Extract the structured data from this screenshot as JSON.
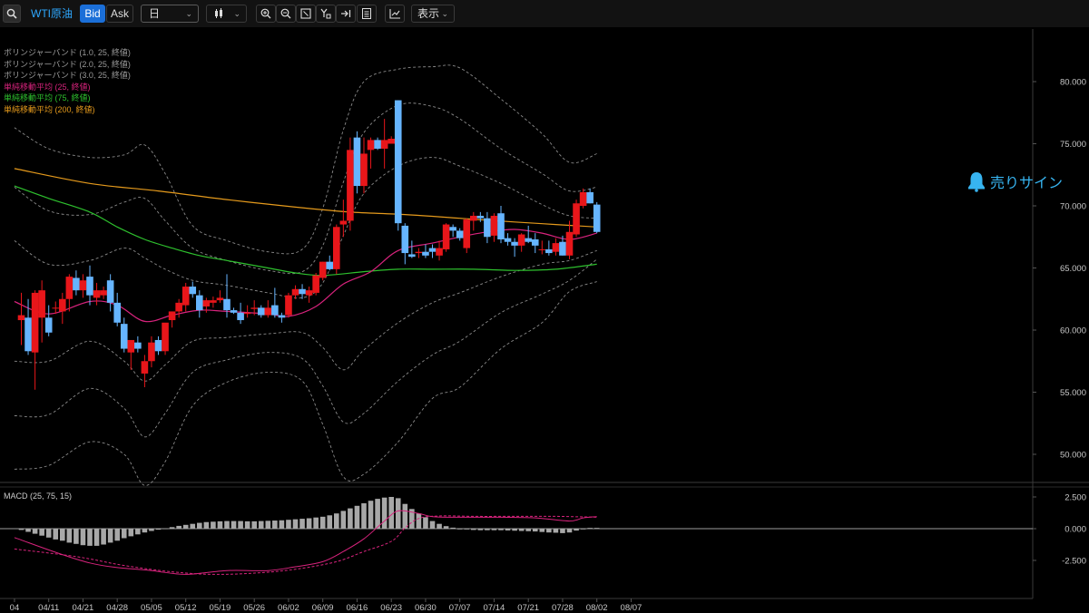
{
  "toolbar": {
    "symbol": "WTI原油",
    "bid": "Bid",
    "ask": "Ask",
    "timeframe": "日",
    "display": "表示"
  },
  "legend": [
    {
      "text": "ボリンジャーバンド (1.0, 25, 終値)",
      "color": "#9a9a9a"
    },
    {
      "text": "ボリンジャーバンド (2.0, 25, 終値)",
      "color": "#9a9a9a"
    },
    {
      "text": "ボリンジャーバンド (3.0, 25, 終値)",
      "color": "#9a9a9a"
    },
    {
      "text": "単純移動平均 (25, 終値)",
      "color": "#d8237d"
    },
    {
      "text": "単純移動平均 (75, 終値)",
      "color": "#2ec12e"
    },
    {
      "text": "単純移動平均 (200, 終値)",
      "color": "#e59a1c"
    }
  ],
  "signal": {
    "label": "売りサイン"
  },
  "macd_label": "MACD (25, 75, 15)",
  "colors": {
    "up": "#e8161a",
    "down": "#66b5ff",
    "sma25": "#d8237d",
    "sma75": "#2ec12e",
    "sma200": "#e59a1c",
    "band": "#8a8a8a",
    "macd_bar": "#a8a8a8",
    "accent": "#2ea8ff"
  },
  "chart_data": {
    "type": "candlestick",
    "price_axis": {
      "ticks": [
        "80.000",
        "75.000",
        "70.000",
        "65.000",
        "60.000",
        "55.000",
        "50.000"
      ],
      "values": [
        80,
        75,
        70,
        65,
        60,
        55,
        50
      ],
      "ylim": [
        47.4,
        84.2
      ]
    },
    "date_ticks": [
      "04",
      "04/11",
      "04/21",
      "04/28",
      "05/05",
      "05/12",
      "05/19",
      "05/26",
      "06/02",
      "06/09",
      "06/16",
      "06/23",
      "06/30",
      "07/07",
      "07/14",
      "07/21",
      "07/28",
      "08/02",
      "08/07"
    ],
    "date_tick_index": [
      -1,
      4,
      9,
      14,
      19,
      24,
      29,
      34,
      39,
      44,
      49,
      54,
      59,
      64,
      69,
      74,
      79,
      84,
      89
    ],
    "candles": [
      {
        "o": 60.8,
        "h": 63.0,
        "l": 58.8,
        "c": 61.2
      },
      {
        "o": 61.0,
        "h": 62.5,
        "l": 58.0,
        "c": 58.3
      },
      {
        "o": 58.2,
        "h": 63.2,
        "l": 55.2,
        "c": 63.0
      },
      {
        "o": 61.0,
        "h": 64.0,
        "l": 59.0,
        "c": 63.2
      },
      {
        "o": 61.0,
        "h": 62.0,
        "l": 59.5,
        "c": 59.8
      },
      {
        "o": 61.8,
        "h": 62.3,
        "l": 61.3,
        "c": 61.8
      },
      {
        "o": 61.5,
        "h": 63.0,
        "l": 60.5,
        "c": 62.5
      },
      {
        "o": 62.5,
        "h": 64.5,
        "l": 61.5,
        "c": 64.3
      },
      {
        "o": 64.2,
        "h": 64.8,
        "l": 62.8,
        "c": 63.2
      },
      {
        "o": 63.2,
        "h": 64.5,
        "l": 62.6,
        "c": 64.0
      },
      {
        "o": 64.3,
        "h": 65.2,
        "l": 62.0,
        "c": 62.8
      },
      {
        "o": 62.6,
        "h": 63.8,
        "l": 62.0,
        "c": 63.2
      },
      {
        "o": 62.8,
        "h": 63.5,
        "l": 62.5,
        "c": 63.2
      },
      {
        "o": 64.0,
        "h": 64.5,
        "l": 61.5,
        "c": 62.2
      },
      {
        "o": 62.2,
        "h": 63.0,
        "l": 60.3,
        "c": 60.6
      },
      {
        "o": 60.5,
        "h": 61.0,
        "l": 58.2,
        "c": 58.5
      },
      {
        "o": 58.2,
        "h": 59.0,
        "l": 56.8,
        "c": 59.2
      },
      {
        "o": 59.0,
        "h": 59.5,
        "l": 58.2,
        "c": 58.5
      },
      {
        "o": 56.5,
        "h": 58.0,
        "l": 55.4,
        "c": 57.5
      },
      {
        "o": 57.5,
        "h": 59.5,
        "l": 57.0,
        "c": 59.0
      },
      {
        "o": 59.2,
        "h": 59.5,
        "l": 58.0,
        "c": 58.3
      },
      {
        "o": 58.3,
        "h": 60.5,
        "l": 58.0,
        "c": 60.6
      },
      {
        "o": 60.8,
        "h": 61.5,
        "l": 60.2,
        "c": 61.5
      },
      {
        "o": 61.5,
        "h": 62.5,
        "l": 61.0,
        "c": 62.2
      },
      {
        "o": 62.0,
        "h": 63.8,
        "l": 61.5,
        "c": 63.5
      },
      {
        "o": 63.5,
        "h": 63.9,
        "l": 62.6,
        "c": 62.9
      },
      {
        "o": 62.8,
        "h": 63.2,
        "l": 61.0,
        "c": 61.6
      },
      {
        "o": 61.9,
        "h": 62.6,
        "l": 61.4,
        "c": 62.4
      },
      {
        "o": 62.2,
        "h": 62.7,
        "l": 61.8,
        "c": 62.4
      },
      {
        "o": 62.4,
        "h": 63.2,
        "l": 62.2,
        "c": 62.6
      },
      {
        "o": 62.5,
        "h": 64.5,
        "l": 61.0,
        "c": 61.6
      },
      {
        "o": 61.6,
        "h": 61.8,
        "l": 61.3,
        "c": 61.4
      },
      {
        "o": 61.4,
        "h": 62.2,
        "l": 60.5,
        "c": 60.8
      },
      {
        "o": 61.3,
        "h": 62.0,
        "l": 61.0,
        "c": 61.4
      },
      {
        "o": 61.7,
        "h": 62.4,
        "l": 61.2,
        "c": 61.8
      },
      {
        "o": 61.8,
        "h": 62.0,
        "l": 61.0,
        "c": 61.2
      },
      {
        "o": 61.2,
        "h": 62.4,
        "l": 61.0,
        "c": 61.8
      },
      {
        "o": 62.0,
        "h": 63.4,
        "l": 61.0,
        "c": 61.2
      },
      {
        "o": 61.2,
        "h": 61.4,
        "l": 60.6,
        "c": 61.0
      },
      {
        "o": 61.2,
        "h": 63.0,
        "l": 61.0,
        "c": 62.8
      },
      {
        "o": 62.8,
        "h": 63.6,
        "l": 62.5,
        "c": 63.3
      },
      {
        "o": 63.3,
        "h": 63.7,
        "l": 62.5,
        "c": 62.9
      },
      {
        "o": 62.8,
        "h": 63.5,
        "l": 62.2,
        "c": 63.2
      },
      {
        "o": 63.0,
        "h": 64.6,
        "l": 62.8,
        "c": 64.4
      },
      {
        "o": 64.2,
        "h": 65.5,
        "l": 64.0,
        "c": 65.5
      },
      {
        "o": 65.5,
        "h": 66.0,
        "l": 64.8,
        "c": 64.9
      },
      {
        "o": 64.9,
        "h": 68.5,
        "l": 64.5,
        "c": 68.3
      },
      {
        "o": 68.5,
        "h": 70.5,
        "l": 67.5,
        "c": 68.8
      },
      {
        "o": 68.8,
        "h": 75.5,
        "l": 68.0,
        "c": 74.5
      },
      {
        "o": 75.5,
        "h": 76.0,
        "l": 71.0,
        "c": 71.6
      },
      {
        "o": 71.6,
        "h": 75.5,
        "l": 71.0,
        "c": 74.2
      },
      {
        "o": 74.5,
        "h": 75.5,
        "l": 73.0,
        "c": 75.3
      },
      {
        "o": 75.3,
        "h": 75.5,
        "l": 74.5,
        "c": 74.6
      },
      {
        "o": 74.6,
        "h": 77.0,
        "l": 73.0,
        "c": 75.3
      },
      {
        "o": 75.0,
        "h": 75.6,
        "l": 75.0,
        "c": 75.4
      },
      {
        "o": 78.5,
        "h": 78.5,
        "l": 68.0,
        "c": 68.6
      },
      {
        "o": 68.4,
        "h": 68.6,
        "l": 65.3,
        "c": 66.2
      },
      {
        "o": 66.1,
        "h": 67.2,
        "l": 65.8,
        "c": 65.9
      },
      {
        "o": 66.2,
        "h": 66.6,
        "l": 65.8,
        "c": 66.3
      },
      {
        "o": 66.3,
        "h": 66.9,
        "l": 65.8,
        "c": 66.0
      },
      {
        "o": 66.6,
        "h": 66.9,
        "l": 65.8,
        "c": 66.3
      },
      {
        "o": 66.0,
        "h": 67.2,
        "l": 65.6,
        "c": 66.6
      },
      {
        "o": 66.5,
        "h": 68.6,
        "l": 66.3,
        "c": 68.5
      },
      {
        "o": 68.3,
        "h": 68.5,
        "l": 67.5,
        "c": 68.0
      },
      {
        "o": 68.0,
        "h": 68.2,
        "l": 67.2,
        "c": 67.4
      },
      {
        "o": 66.6,
        "h": 69.0,
        "l": 66.2,
        "c": 68.9
      },
      {
        "o": 68.8,
        "h": 69.5,
        "l": 68.0,
        "c": 69.2
      },
      {
        "o": 69.2,
        "h": 69.5,
        "l": 68.7,
        "c": 69.0
      },
      {
        "o": 69.0,
        "h": 69.5,
        "l": 67.0,
        "c": 67.5
      },
      {
        "o": 67.6,
        "h": 69.4,
        "l": 67.1,
        "c": 69.2
      },
      {
        "o": 69.4,
        "h": 70.0,
        "l": 67.0,
        "c": 67.3
      },
      {
        "o": 67.4,
        "h": 67.8,
        "l": 66.8,
        "c": 67.1
      },
      {
        "o": 67.1,
        "h": 67.4,
        "l": 65.9,
        "c": 66.8
      },
      {
        "o": 66.8,
        "h": 67.8,
        "l": 66.3,
        "c": 67.7
      },
      {
        "o": 67.4,
        "h": 68.4,
        "l": 67.0,
        "c": 67.1
      },
      {
        "o": 67.3,
        "h": 67.8,
        "l": 66.2,
        "c": 66.8
      },
      {
        "o": 66.5,
        "h": 67.2,
        "l": 66.1,
        "c": 66.5
      },
      {
        "o": 66.5,
        "h": 67.2,
        "l": 66.0,
        "c": 66.2
      },
      {
        "o": 66.3,
        "h": 67.4,
        "l": 66.0,
        "c": 67.0
      },
      {
        "o": 67.1,
        "h": 67.6,
        "l": 66.0,
        "c": 66.0
      },
      {
        "o": 66.0,
        "h": 68.8,
        "l": 65.7,
        "c": 67.9
      },
      {
        "o": 67.7,
        "h": 70.5,
        "l": 67.5,
        "c": 70.2
      },
      {
        "o": 70.0,
        "h": 71.4,
        "l": 69.8,
        "c": 71.1
      },
      {
        "o": 71.1,
        "h": 71.4,
        "l": 70.2,
        "c": 70.2
      },
      {
        "o": 70.1,
        "h": 70.3,
        "l": 67.8,
        "c": 67.9
      }
    ],
    "sma25": [
      [
        -1,
        62.3
      ],
      [
        4,
        61.3
      ],
      [
        10,
        62.3
      ],
      [
        14,
        62.0
      ],
      [
        18,
        60.7
      ],
      [
        22,
        61.2
      ],
      [
        26,
        61.6
      ],
      [
        30,
        61.5
      ],
      [
        36,
        61.3
      ],
      [
        39,
        61.1
      ],
      [
        43,
        61.9
      ],
      [
        47,
        63.7
      ],
      [
        51,
        64.7
      ],
      [
        55,
        66.4
      ],
      [
        60,
        67.0
      ],
      [
        64,
        67.5
      ],
      [
        68,
        67.9
      ],
      [
        72,
        68.1
      ],
      [
        76,
        67.8
      ],
      [
        80,
        67.3
      ],
      [
        84,
        67.8
      ]
    ],
    "sma75": [
      [
        -1,
        71.6
      ],
      [
        4,
        70.6
      ],
      [
        10,
        69.5
      ],
      [
        14,
        68.3
      ],
      [
        18,
        67.3
      ],
      [
        22,
        66.6
      ],
      [
        26,
        66.0
      ],
      [
        30,
        65.6
      ],
      [
        36,
        65.0
      ],
      [
        40,
        64.6
      ],
      [
        44,
        64.4
      ],
      [
        50,
        64.7
      ],
      [
        55,
        64.9
      ],
      [
        60,
        64.9
      ],
      [
        66,
        64.9
      ],
      [
        72,
        64.8
      ],
      [
        78,
        64.9
      ],
      [
        84,
        65.3
      ]
    ],
    "sma200": [
      [
        -1,
        73.0
      ],
      [
        10,
        71.8
      ],
      [
        20,
        71.2
      ],
      [
        30,
        70.5
      ],
      [
        40,
        69.9
      ],
      [
        48,
        69.5
      ],
      [
        56,
        69.3
      ],
      [
        64,
        69.0
      ],
      [
        72,
        68.7
      ],
      [
        78,
        68.5
      ],
      [
        84,
        68.3
      ]
    ],
    "bb1_upper": [
      [
        -1,
        67.2
      ],
      [
        4,
        65.3
      ],
      [
        10,
        65.6
      ],
      [
        15,
        66.6
      ],
      [
        18,
        65.8
      ],
      [
        21,
        64.9
      ],
      [
        25,
        64.0
      ],
      [
        30,
        63.6
      ],
      [
        36,
        63.0
      ],
      [
        41,
        62.6
      ],
      [
        44,
        63.8
      ],
      [
        47,
        67.6
      ],
      [
        50,
        71.0
      ],
      [
        55,
        73.2
      ],
      [
        60,
        73.9
      ],
      [
        64,
        73.2
      ],
      [
        70,
        71.8
      ],
      [
        76,
        70.1
      ],
      [
        80,
        69.2
      ],
      [
        84,
        69.0
      ]
    ],
    "bb1_lower": [
      [
        -1,
        57.5
      ],
      [
        4,
        57.5
      ],
      [
        10,
        59.1
      ],
      [
        15,
        57.5
      ],
      [
        18,
        55.9
      ],
      [
        21,
        57.2
      ],
      [
        25,
        59.1
      ],
      [
        30,
        59.4
      ],
      [
        36,
        59.7
      ],
      [
        41,
        59.8
      ],
      [
        44,
        58.6
      ],
      [
        47,
        56.8
      ],
      [
        50,
        58.4
      ],
      [
        55,
        60.6
      ],
      [
        60,
        62.2
      ],
      [
        64,
        63.0
      ],
      [
        70,
        64.3
      ],
      [
        76,
        65.3
      ],
      [
        80,
        65.6
      ],
      [
        84,
        66.4
      ]
    ],
    "bb2_upper": [
      [
        -1,
        71.5
      ],
      [
        4,
        69.6
      ],
      [
        10,
        69.3
      ],
      [
        15,
        70.3
      ],
      [
        18,
        70.6
      ],
      [
        21,
        68.8
      ],
      [
        25,
        66.6
      ],
      [
        30,
        65.6
      ],
      [
        36,
        64.8
      ],
      [
        41,
        64.7
      ],
      [
        44,
        66.8
      ],
      [
        47,
        71.9
      ],
      [
        50,
        75.9
      ],
      [
        55,
        78.1
      ],
      [
        60,
        78.0
      ],
      [
        64,
        77.0
      ],
      [
        70,
        74.6
      ],
      [
        76,
        72.6
      ],
      [
        80,
        71.2
      ],
      [
        84,
        71.5
      ]
    ],
    "bb2_lower": [
      [
        -1,
        53.1
      ],
      [
        4,
        53.2
      ],
      [
        10,
        55.3
      ],
      [
        15,
        53.7
      ],
      [
        18,
        51.4
      ],
      [
        21,
        53.3
      ],
      [
        25,
        56.6
      ],
      [
        30,
        57.6
      ],
      [
        36,
        58.2
      ],
      [
        41,
        57.7
      ],
      [
        44,
        55.5
      ],
      [
        47,
        52.6
      ],
      [
        50,
        53.3
      ],
      [
        55,
        55.9
      ],
      [
        60,
        58.0
      ],
      [
        64,
        59.1
      ],
      [
        70,
        61.4
      ],
      [
        76,
        62.9
      ],
      [
        80,
        64.0
      ],
      [
        84,
        65.7
      ]
    ],
    "bb3_upper": [
      [
        -1,
        76.3
      ],
      [
        4,
        74.6
      ],
      [
        10,
        73.9
      ],
      [
        15,
        74.1
      ],
      [
        18,
        74.9
      ],
      [
        21,
        72.6
      ],
      [
        25,
        68.4
      ],
      [
        30,
        67.2
      ],
      [
        36,
        66.3
      ],
      [
        41,
        66.5
      ],
      [
        44,
        69.8
      ],
      [
        47,
        76.1
      ],
      [
        50,
        80.0
      ],
      [
        55,
        81.0
      ],
      [
        60,
        81.2
      ],
      [
        64,
        81.1
      ],
      [
        70,
        78.6
      ],
      [
        76,
        75.8
      ],
      [
        80,
        73.5
      ],
      [
        84,
        74.2
      ]
    ],
    "bb3_lower": [
      [
        -1,
        48.8
      ],
      [
        4,
        49.1
      ],
      [
        10,
        51.0
      ],
      [
        15,
        50.0
      ],
      [
        18,
        47.5
      ],
      [
        21,
        49.4
      ],
      [
        25,
        53.9
      ],
      [
        30,
        55.8
      ],
      [
        36,
        56.6
      ],
      [
        41,
        55.9
      ],
      [
        44,
        52.4
      ],
      [
        47,
        48.2
      ],
      [
        50,
        48.4
      ],
      [
        55,
        51.0
      ],
      [
        60,
        54.5
      ],
      [
        64,
        55.4
      ],
      [
        70,
        58.5
      ],
      [
        76,
        60.6
      ],
      [
        80,
        63.1
      ],
      [
        84,
        63.9
      ]
    ],
    "macd_axis": {
      "ticks": [
        "2.500",
        "0.000",
        "-2.500"
      ],
      "values": [
        2.5,
        0,
        -2.5
      ],
      "ylim": [
        -4.6,
        2.9
      ]
    },
    "macd_hist": [
      -0.1,
      -0.25,
      -0.4,
      -0.55,
      -0.7,
      -0.85,
      -0.95,
      -1.1,
      -1.2,
      -1.3,
      -1.35,
      -1.35,
      -1.25,
      -1.1,
      -0.95,
      -0.75,
      -0.6,
      -0.45,
      -0.3,
      -0.18,
      -0.08,
      0.02,
      0.12,
      0.22,
      0.3,
      0.38,
      0.46,
      0.52,
      0.55,
      0.58,
      0.6,
      0.6,
      0.6,
      0.58,
      0.58,
      0.6,
      0.62,
      0.64,
      0.66,
      0.7,
      0.74,
      0.78,
      0.82,
      0.88,
      0.94,
      1.05,
      1.2,
      1.4,
      1.6,
      1.8,
      2.0,
      2.2,
      2.35,
      2.45,
      2.5,
      2.4,
      1.95,
      1.55,
      1.2,
      0.9,
      0.6,
      0.38,
      0.2,
      0.08,
      0.0,
      -0.06,
      -0.1,
      -0.12,
      -0.12,
      -0.12,
      -0.12,
      -0.14,
      -0.16,
      -0.18,
      -0.2,
      -0.22,
      -0.26,
      -0.3,
      -0.32,
      -0.35,
      -0.3,
      -0.15,
      0.0,
      0.06,
      0.06
    ],
    "macd_line": [
      [
        -1,
        -0.7
      ],
      [
        10,
        -2.7
      ],
      [
        19,
        -3.3
      ],
      [
        24,
        -3.6
      ],
      [
        30,
        -3.3
      ],
      [
        36,
        -3.3
      ],
      [
        40,
        -3.0
      ],
      [
        44,
        -2.6
      ],
      [
        47,
        -1.8
      ],
      [
        50,
        -0.8
      ],
      [
        53,
        0.6
      ],
      [
        55,
        1.4
      ],
      [
        58,
        1.2
      ],
      [
        60,
        0.95
      ],
      [
        64,
        0.9
      ],
      [
        70,
        0.9
      ],
      [
        75,
        0.85
      ],
      [
        80,
        0.6
      ],
      [
        82,
        0.85
      ],
      [
        84,
        0.95
      ]
    ],
    "signal_line": [
      [
        -1,
        -1.6
      ],
      [
        8,
        -2.2
      ],
      [
        15,
        -2.9
      ],
      [
        22,
        -3.4
      ],
      [
        28,
        -3.6
      ],
      [
        34,
        -3.5
      ],
      [
        40,
        -3.2
      ],
      [
        46,
        -2.6
      ],
      [
        50,
        -1.8
      ],
      [
        54,
        -1.0
      ],
      [
        56,
        0.05
      ],
      [
        58,
        0.8
      ],
      [
        61,
        1.0
      ],
      [
        66,
        0.97
      ],
      [
        72,
        0.97
      ],
      [
        78,
        0.97
      ],
      [
        84,
        0.9
      ]
    ]
  }
}
